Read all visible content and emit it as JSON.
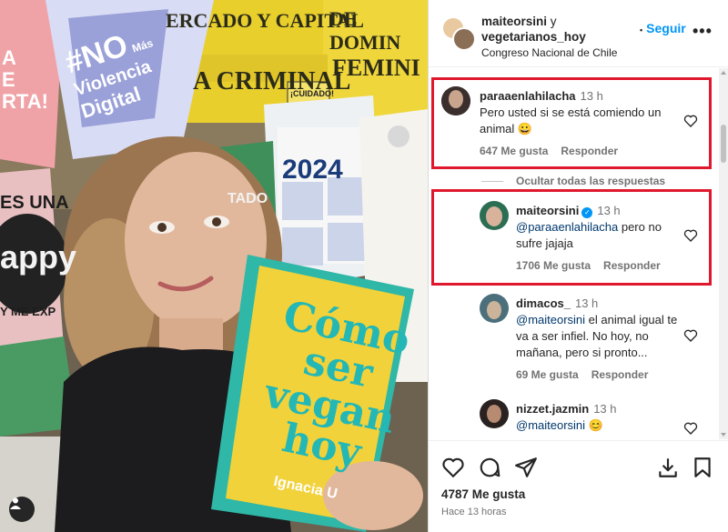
{
  "photo": {
    "posters": {
      "no_violencia": [
        "#NO",
        "Más",
        "Violencia",
        "Digital"
      ],
      "banner_top": "ERCADO Y CAPITAL",
      "banner_top_right": "DE DOMIN",
      "banner_mid": "A CRIMINAL",
      "banner_mid_right": "FEMINI",
      "cuidado": "¡CUIDADO!",
      "year": "2024",
      "left_pink": [
        "A",
        "E",
        "RTA!"
      ],
      "left_dark": [
        "ES UNA",
        "appy",
        "Y ME EXP"
      ],
      "tado": [
        "ADO",
        "TADO"
      ],
      "book_title": [
        "Cómo",
        "ser",
        "vegan",
        "hoy"
      ],
      "book_author": "Ignacia U"
    }
  },
  "header": {
    "user1": "maiteorsini",
    "conj": "y",
    "user2": "vegetarianos_hoy",
    "location": "Congreso Nacional de Chile",
    "follow": "Seguir",
    "more": "•••"
  },
  "comments": [
    {
      "user": "paraaenlahilacha",
      "time": "13 h",
      "text": "Pero usted si se está comiendo un animal 😀",
      "likes": "647 Me gusta",
      "reply": "Responder"
    },
    {
      "hide_replies": "Ocultar todas las respuestas"
    },
    {
      "user": "maiteorsini",
      "time": "13 h",
      "mention": "@paraaenlahilacha",
      "text": " pero no sufre jajaja",
      "likes": "1706 Me gusta",
      "reply": "Responder"
    },
    {
      "user": "dimacos_",
      "time": "13 h",
      "mention": "@maiteorsini",
      "text": " el animal igual te va a ser infiel. No hoy, no mañana, pero si pronto...",
      "likes": "69 Me gusta",
      "reply": "Responder"
    },
    {
      "user": "nizzet.jazmin",
      "time": "13 h",
      "mention": "@maiteorsini",
      "text": " 😊"
    }
  ],
  "footer": {
    "likes": "4787 Me gusta",
    "posted": "Hace 13 horas"
  },
  "colors": {
    "accent": "#0095f6",
    "highlight_box": "#e0182d",
    "book": "#f2d23a"
  }
}
